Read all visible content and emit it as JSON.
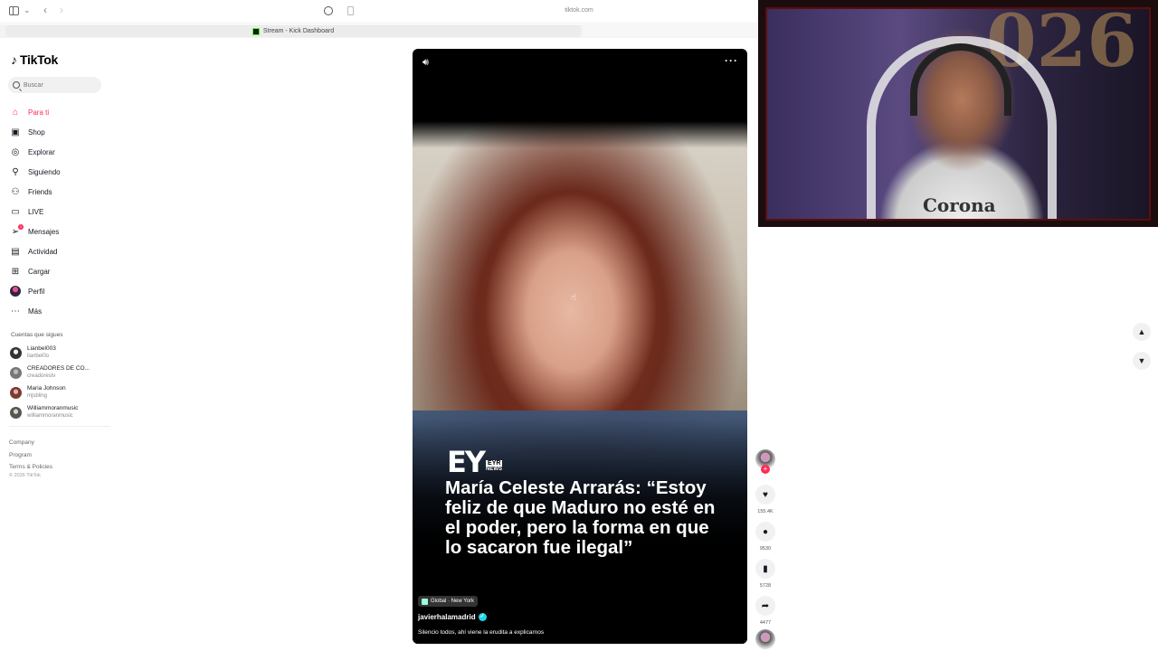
{
  "browser": {
    "url": "tiktok.com",
    "tab_title": "Stream - Kick Dashboard"
  },
  "sidebar": {
    "logo": "TikTok",
    "search_placeholder": "Buscar",
    "nav": [
      {
        "label": "Para ti",
        "icon": "home-icon",
        "active": true
      },
      {
        "label": "Shop",
        "icon": "shop-icon"
      },
      {
        "label": "Explorar",
        "icon": "compass-icon"
      },
      {
        "label": "Siguiendo",
        "icon": "following-icon"
      },
      {
        "label": "Friends",
        "icon": "friends-icon"
      },
      {
        "label": "LIVE",
        "icon": "live-icon"
      },
      {
        "label": "Mensajes",
        "icon": "messages-icon",
        "badge": "1"
      },
      {
        "label": "Actividad",
        "icon": "activity-icon"
      },
      {
        "label": "Cargar",
        "icon": "upload-icon"
      },
      {
        "label": "Perfil",
        "icon": "profile-avatar"
      },
      {
        "label": "Más",
        "icon": "more-icon"
      }
    ],
    "following_title": "Cuentas que sigues",
    "following": [
      {
        "name": "Lianbel003",
        "handle": "lianbel0o"
      },
      {
        "name": "CREADORES DE CO...",
        "handle": "creadorestv"
      },
      {
        "name": "Maria Johnson",
        "handle": "mjsbling"
      },
      {
        "name": "Williammoranmusic",
        "handle": "williammoranmusic"
      }
    ],
    "footer": [
      "Company",
      "Program",
      "Terms & Policies"
    ],
    "copyright": "© 2026 TikTok"
  },
  "video": {
    "brand_big": "EY",
    "brand_small_1": "EYR",
    "brand_small_2": "NEWS",
    "headline": "María Celeste Arrarás: “Estoy feliz de que Maduro no esté en el poder, pero la forma en que lo sacaron fue ilegal”",
    "location": "Global · New York",
    "author": "javierhalamadrid",
    "caption": "Silencio todos, ahí viene la erudita a explicarnos"
  },
  "actions": {
    "likes": "155.4K",
    "comments": "9530",
    "saves": "5728",
    "shares": "4477"
  },
  "webcam": {
    "shirt_text": "Corona",
    "balloon_text": "026"
  },
  "colors": {
    "accent": "#fe2c55",
    "verified": "#20d5ec",
    "webcam_border": "#5c0d0d"
  }
}
